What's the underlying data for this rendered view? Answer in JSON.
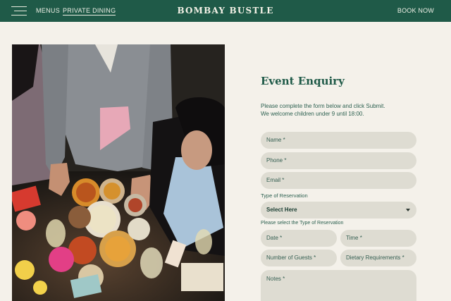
{
  "header": {
    "brand": "BOMBAY BUSTLE",
    "nav": {
      "menus": "MENUS",
      "private_dining": "PRIVATE DINING"
    },
    "book_now": "BOOK NOW"
  },
  "photo": {
    "alt": "Guests sharing Indian dishes at a table"
  },
  "form": {
    "title": "Event Enquiry",
    "intro_line1": "Please complete the form below and click Submit.",
    "intro_line2": "We welcome children under 9 until 18:00.",
    "name_placeholder": "Name *",
    "phone_placeholder": "Phone *",
    "email_placeholder": "Email *",
    "reservation_type_label": "Type of Reservation",
    "reservation_type_value": "Select Here",
    "reservation_type_hint": "Please select the Type of Reservation",
    "date_placeholder": "Date *",
    "time_placeholder": "Time *",
    "guests_placeholder": "Number of Guests *",
    "dietary_placeholder": "Dietary Requirements *",
    "notes_placeholder": "Notes *"
  },
  "colors": {
    "brand_green": "#1f5a48",
    "page_bg": "#f4f1ea",
    "field_bg": "#dedcd2"
  }
}
